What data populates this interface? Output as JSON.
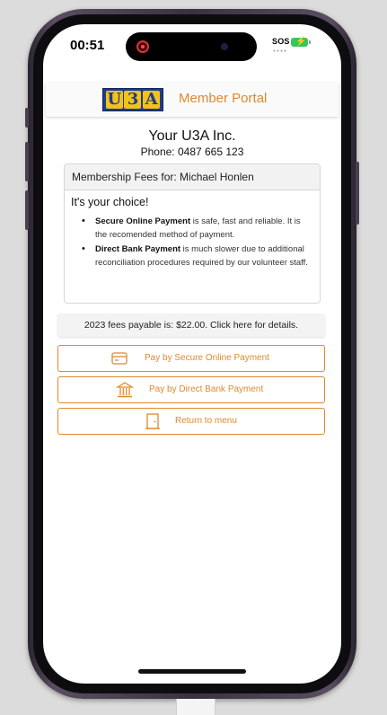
{
  "status_bar": {
    "time": "00:51",
    "sos": "SOS"
  },
  "header": {
    "logo_letters": [
      "U",
      "3",
      "A"
    ],
    "title": "Member Portal"
  },
  "org": {
    "name": "Your U3A Inc.",
    "phone": "Phone: 0487 665 123"
  },
  "membership": {
    "header": "Membership Fees for: Michael Honlen",
    "choice_title": "It's your choice!",
    "options": [
      {
        "bold": "Secure Online Payment",
        "text": " is safe, fast and reliable. It is the recomended method of payment."
      },
      {
        "bold": "Direct Bank Payment",
        "text": " is much slower due to additional reconciliation procedures required by our volunteer staff."
      }
    ]
  },
  "fees_notice": "2023 fees payable is: $22.00. Click here for details.",
  "buttons": {
    "online": {
      "label": "Pay by Secure Online Payment",
      "icon": "credit-card-icon"
    },
    "bank": {
      "label": "Pay by Direct Bank Payment",
      "icon": "bank-icon"
    },
    "menu": {
      "label": "Return to menu",
      "icon": "door-icon"
    }
  },
  "colors": {
    "accent": "#e0892c",
    "logo_blue": "#1f3c8c",
    "logo_gold": "#f2c21b",
    "battery": "#34c759"
  }
}
